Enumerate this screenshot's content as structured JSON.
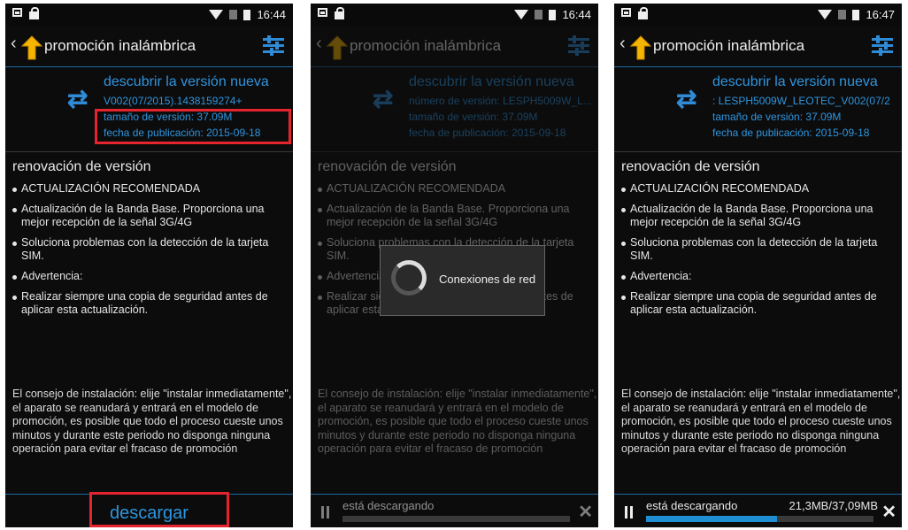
{
  "status": {
    "time1": "16:44",
    "time2": "16:44",
    "time3": "16:47"
  },
  "header": {
    "back_icon": "chevron-left-icon",
    "title": "promoción inalámbrica",
    "settings_icon": "sliders-icon",
    "accent": "#2f8bd6"
  },
  "version_info": {
    "title": "descubrir la versión nueva",
    "version_p1": "V002(07/2015).1438159274+",
    "version_p2": "número de versión:  LESPH5009W_L...",
    "version_p3": ":  LESPH5009W_LEOTEC_V002(07/2",
    "size": "tamaño de versión:  37.09M",
    "date": "fecha de publicación:  2015-09-18"
  },
  "renewal": {
    "title": "renovación de versión",
    "items": [
      "ACTUALIZACIÓN RECOMENDADA",
      "Actualización de la Banda Base. Proporciona una mejor recepción de la señal 3G/4G",
      "Soluciona problemas con la detección de la tarjeta SIM.",
      "Advertencia:",
      "Realizar siempre una copia de seguridad antes de aplicar esta actualización."
    ]
  },
  "advice": "El consejo de instalación: elije \"instalar inmediatamente\", el aparato se reanudará y entrará en el modelo de promoción, es posible que todo el proceso cueste unos minutos y durante este periodo no disponga ninguna operación para evitar el fracaso de promoción",
  "download": {
    "button_label": "descargar",
    "status_text": "está descargando",
    "progress_text": "21,3MB/37,09MB",
    "progress_fraction_p3": 0.574,
    "progress_fraction_p2": 0
  },
  "dialog": {
    "text": "Conexiones de red"
  },
  "highlight_color": "#e5242d"
}
